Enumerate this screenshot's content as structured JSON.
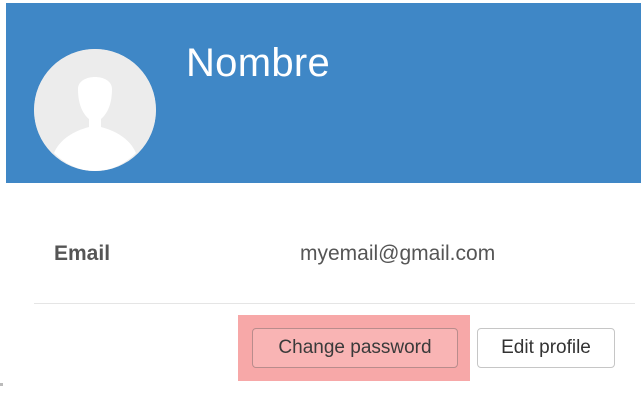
{
  "profile": {
    "name": "Nombre",
    "avatar_icon": "user-silhouette-icon"
  },
  "details": {
    "email_label": "Email",
    "email_value": "myemail@gmail.com"
  },
  "actions": {
    "change_password_label": "Change password",
    "edit_profile_label": "Edit profile"
  },
  "colors": {
    "header_bg": "#3f87c6",
    "highlight": "#f7a8a8"
  }
}
